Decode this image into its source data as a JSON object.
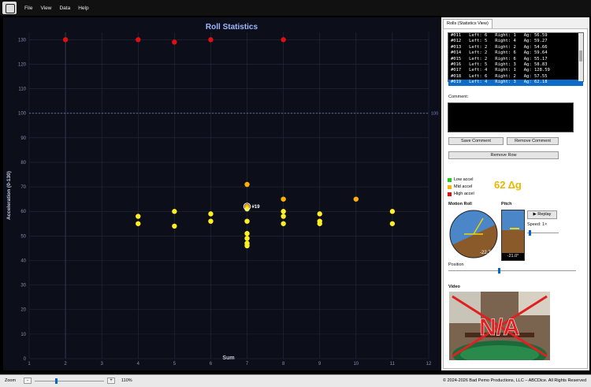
{
  "menu": [
    "File",
    "View",
    "Data",
    "Help"
  ],
  "chart_data": {
    "type": "scatter",
    "title": "Roll Statistics",
    "xlabel": "Sum",
    "ylabel": "Acceleration (0-130)",
    "xlim": [
      1,
      12
    ],
    "ylim": [
      0,
      133
    ],
    "xticks": [
      "1",
      "2",
      "3",
      "4",
      "5",
      "6",
      "7",
      "8",
      "9",
      "10",
      "11",
      "12"
    ],
    "yticks": [
      "0",
      "10",
      "20",
      "30",
      "40",
      "50",
      "60",
      "70",
      "80",
      "90",
      "100",
      "110",
      "120",
      "130"
    ],
    "threshold": {
      "value": 100,
      "label": "100"
    },
    "highlight": {
      "label": "#19",
      "x": 7,
      "y": 62
    },
    "points": [
      {
        "x": 2,
        "y": 130,
        "c": "high"
      },
      {
        "x": 4,
        "y": 130,
        "c": "high"
      },
      {
        "x": 5,
        "y": 129,
        "c": "high"
      },
      {
        "x": 6,
        "y": 130,
        "c": "high"
      },
      {
        "x": 8,
        "y": 130,
        "c": "high"
      },
      {
        "x": 7,
        "y": 71,
        "c": "mid"
      },
      {
        "x": 8,
        "y": 65,
        "c": "mid"
      },
      {
        "x": 10,
        "y": 65,
        "c": "mid"
      },
      {
        "x": 7,
        "y": 62,
        "c": "mid"
      },
      {
        "x": 4,
        "y": 58,
        "c": "low"
      },
      {
        "x": 4,
        "y": 55,
        "c": "low"
      },
      {
        "x": 5,
        "y": 60,
        "c": "low"
      },
      {
        "x": 5,
        "y": 54,
        "c": "low"
      },
      {
        "x": 6,
        "y": 59,
        "c": "low"
      },
      {
        "x": 6,
        "y": 56,
        "c": "low"
      },
      {
        "x": 7,
        "y": 61,
        "c": "low"
      },
      {
        "x": 7,
        "y": 56,
        "c": "low"
      },
      {
        "x": 7,
        "y": 51,
        "c": "low"
      },
      {
        "x": 7,
        "y": 49,
        "c": "low"
      },
      {
        "x": 7,
        "y": 47,
        "c": "low"
      },
      {
        "x": 7,
        "y": 46,
        "c": "low"
      },
      {
        "x": 8,
        "y": 60,
        "c": "low"
      },
      {
        "x": 8,
        "y": 58,
        "c": "low"
      },
      {
        "x": 8,
        "y": 55,
        "c": "low"
      },
      {
        "x": 9,
        "y": 59,
        "c": "low"
      },
      {
        "x": 9,
        "y": 56,
        "c": "low"
      },
      {
        "x": 9,
        "y": 55,
        "c": "low"
      },
      {
        "x": 11,
        "y": 60,
        "c": "low"
      },
      {
        "x": 11,
        "y": 55,
        "c": "low"
      }
    ],
    "colors": {
      "low": "#ffee22",
      "mid": "#ffb000",
      "high": "#e01010"
    }
  },
  "panel": {
    "tab": "Rolls (Statistics View)",
    "rolls": [
      "#011   Left: 6   Right: 1   Ag: 56.59",
      "#012   Left: 5   Right: 4   Ag: 59.27",
      "#013   Left: 2   Right: 2   Ag: 54.66",
      "#014   Left: 2   Right: 6   Ag: 59.64",
      "#015   Left: 2   Right: 6   Ag: 55.17",
      "#016   Left: 5   Right: 3   Ag: 58.83",
      "#017   Left: 4   Right: 1   Ag: 128.59",
      "#018   Left: 6   Right: 2   Ag: 57.55",
      "#019   Left: 4   Right: 3   Ag: 62.18"
    ],
    "comment_label": "Comment:",
    "save_comment": "Save Comment",
    "remove_comment": "Remove Comment",
    "remove_row": "Remove Row",
    "legend": [
      {
        "label": "Low accel",
        "color": "#22cc22"
      },
      {
        "label": "Mid accel",
        "color": "#ffb000"
      },
      {
        "label": "High accel",
        "color": "#e01010"
      }
    ],
    "g_value": "62 Δg",
    "motion_roll_label": "Motion Roll",
    "pitch_label": "Pitch",
    "roll_readout": "-22.7°",
    "pitch_readout": "-21.0°",
    "replay": "▶ Replay",
    "speed": "Speed: 1×",
    "position_label": "Position",
    "video_label": "Video",
    "video_na": "N/A"
  },
  "status": {
    "zoom_label": "Zoom",
    "zoom_minus": "-",
    "zoom_plus": "+",
    "zoom_value": "110%",
    "copyright": "© 2024-2026  Bad Pemo Productions, LLC – ABCDice.  All Rights Reserved"
  }
}
